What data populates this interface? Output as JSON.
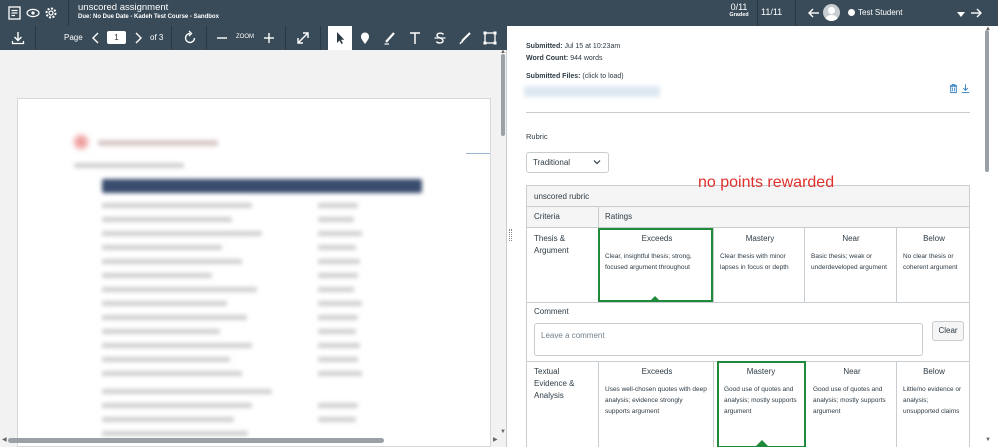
{
  "header": {
    "assignment_title": "unscored assignment",
    "assignment_sub": "Due: No Due Date - Kadeh Test Course - Sandbox",
    "graded_count": "0/11",
    "graded_label": "Graded",
    "student_counter": "11/11",
    "student_name": "Test Student",
    "icons": [
      "gradebook-icon",
      "eye-icon",
      "gear-icon",
      "arrow-left-icon",
      "avatar",
      "chevron-down-icon",
      "arrow-right-icon"
    ]
  },
  "doc_toolbar": {
    "page_label": "Page",
    "page_value": "1",
    "of_label": "of 3",
    "zoom_label": "ZOOM",
    "icons": [
      "download-icon",
      "chevron-left-icon",
      "chevron-right-icon",
      "rotate-icon",
      "zoom-out-icon",
      "zoom-in-icon",
      "expand-icon",
      "pointer-icon",
      "pin-icon",
      "highlight-icon",
      "text-icon",
      "strikethrough-icon",
      "draw-icon",
      "area-icon"
    ]
  },
  "submission": {
    "submitted_label": "Submitted:",
    "submitted_value": "Jul 15 at 10:23am",
    "word_count_label": "Word Count:",
    "word_count_value": "944 words",
    "files_label": "Submitted Files:",
    "files_hint": "(click to load)"
  },
  "rubric": {
    "label": "Rubric",
    "selected_type": "Traditional",
    "annotation": "no points rewarded",
    "title": "unscored rubric",
    "criteria_header": "Criteria",
    "ratings_header": "Ratings",
    "comment_label": "Comment",
    "comment_placeholder": "Leave a comment",
    "clear_label": "Clear",
    "criteria": [
      {
        "name": "Thesis & Argument",
        "ratings": [
          {
            "title": "Exceeds",
            "desc": "Clear, insightful thesis; strong, focused argument throughout",
            "selected": true
          },
          {
            "title": "Mastery",
            "desc": "Clear thesis with minor lapses in focus or depth",
            "selected": false
          },
          {
            "title": "Near",
            "desc": "Basic thesis; weak or underdeveloped argument",
            "selected": false
          },
          {
            "title": "Below",
            "desc": "No clear thesis or coherent argument",
            "selected": false
          }
        ]
      },
      {
        "name": "Textual Evidence & Analysis",
        "ratings": [
          {
            "title": "Exceeds",
            "desc": "Uses well-chosen quotes with deep analysis; evidence strongly supports argument",
            "selected": false
          },
          {
            "title": "Mastery",
            "desc": "Good use of quotes and analysis; mostly supports argument",
            "selected": true
          },
          {
            "title": "Near",
            "desc": "Good use of quotes and analysis; mostly supports argument",
            "selected": false
          },
          {
            "title": "Below",
            "desc": "Little/no evidence or analysis; unsupported claims",
            "selected": false
          }
        ]
      }
    ]
  },
  "colors": {
    "topbar": "#394b58",
    "selected_border": "#1e8a3a",
    "annotation": "#e0302b"
  }
}
